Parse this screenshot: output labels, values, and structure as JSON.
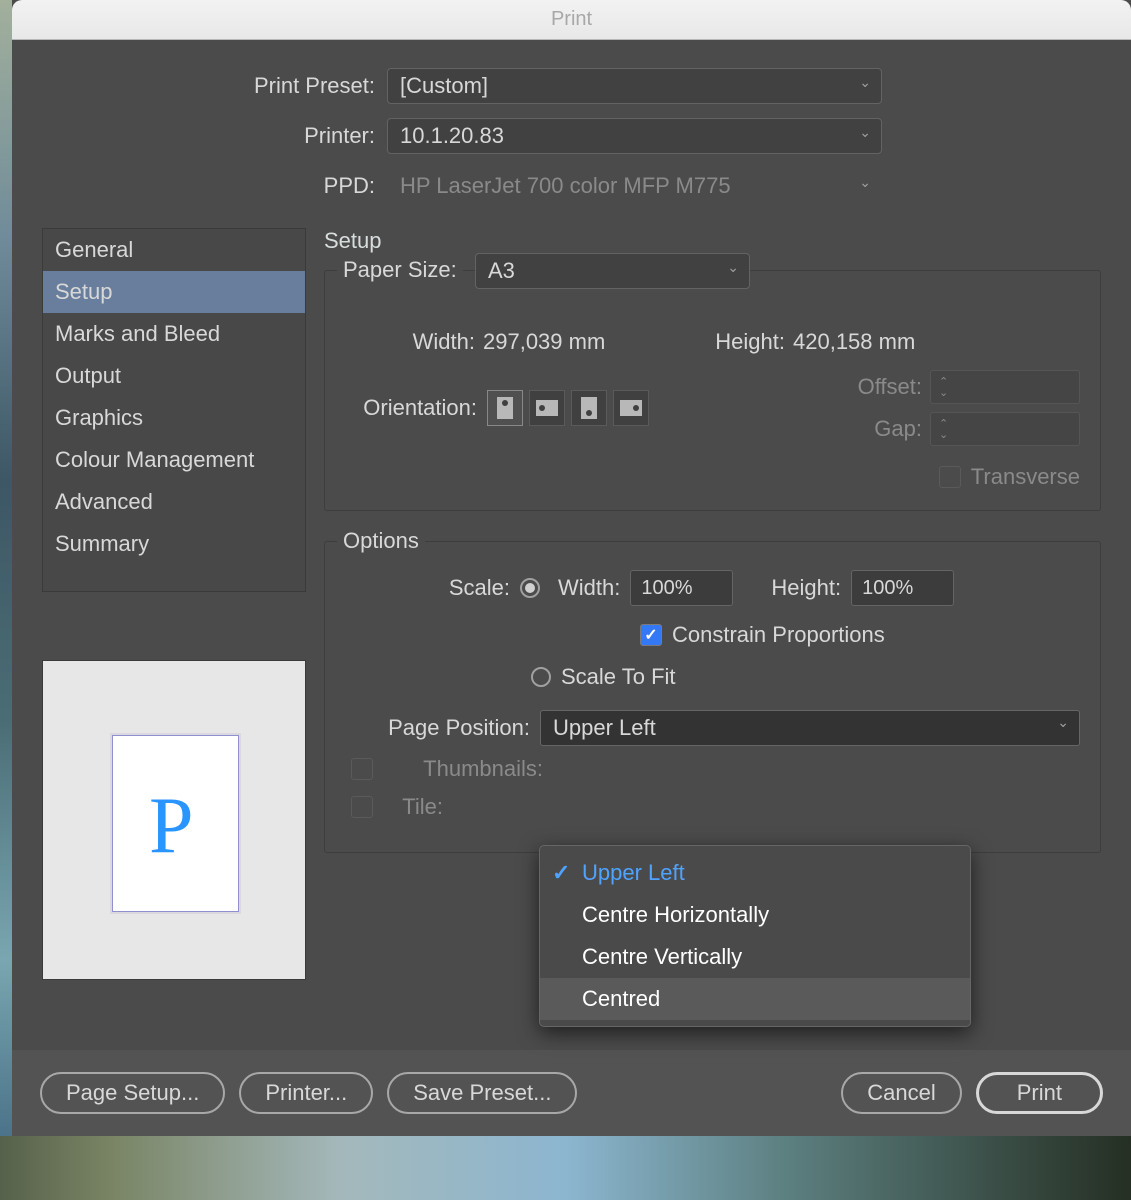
{
  "window": {
    "title": "Print"
  },
  "topForm": {
    "presetLabel": "Print Preset:",
    "presetValue": "[Custom]",
    "printerLabel": "Printer:",
    "printerValue": "10.1.20.83",
    "ppdLabel": "PPD:",
    "ppdValue": "HP LaserJet 700 color MFP M775"
  },
  "sidebar": {
    "items": [
      "General",
      "Setup",
      "Marks and Bleed",
      "Output",
      "Graphics",
      "Colour Management",
      "Advanced",
      "Summary"
    ],
    "selectedIndex": 1
  },
  "panel": {
    "title": "Setup"
  },
  "paper": {
    "sizeLabel": "Paper Size:",
    "sizeValue": "A3",
    "widthLabel": "Width:",
    "widthValue": "297,039 mm",
    "heightLabel": "Height:",
    "heightValue": "420,158 mm",
    "orientationLabel": "Orientation:",
    "offsetLabel": "Offset:",
    "gapLabel": "Gap:",
    "transverseLabel": "Transverse"
  },
  "options": {
    "legend": "Options",
    "scaleLabel": "Scale:",
    "widthLabel": "Width:",
    "widthValue": "100%",
    "heightLabel": "Height:",
    "heightValue": "100%",
    "constrainLabel": "Constrain Proportions",
    "scaleToFitLabel": "Scale To Fit",
    "pagePositionLabel": "Page Position:",
    "pagePositionValue": "Upper Left",
    "pagePositionMenu": [
      "Upper Left",
      "Centre Horizontally",
      "Centre Vertically",
      "Centred"
    ],
    "thumbnailsLabel": "Thumbnails:",
    "tileLabel": "Tile:"
  },
  "footer": {
    "pageSetup": "Page Setup...",
    "printer": "Printer...",
    "savePreset": "Save Preset...",
    "cancel": "Cancel",
    "print": "Print"
  }
}
